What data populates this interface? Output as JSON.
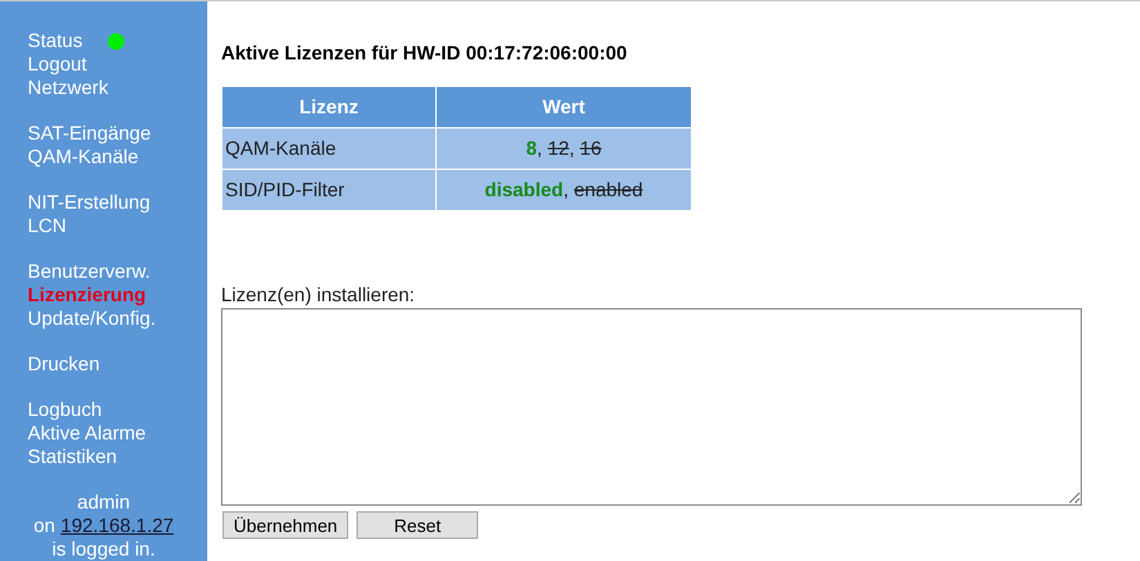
{
  "sidebar": {
    "groups": [
      [
        {
          "label": "Status",
          "selected": false,
          "color": "#00ee00"
        },
        {
          "label": "Logout",
          "selected": false
        },
        {
          "label": "Netzwerk",
          "selected": false
        }
      ],
      [
        {
          "label": "SAT-Eingänge",
          "selected": false
        },
        {
          "label": "QAM-Kanäle",
          "selected": false
        }
      ],
      [
        {
          "label": "NIT-Erstellung",
          "selected": false
        },
        {
          "label": "LCN",
          "selected": false
        }
      ],
      [
        {
          "label": "Benutzerverw.",
          "selected": false
        },
        {
          "label": "Lizenzierung",
          "selected": true
        },
        {
          "label": "Update/Konfig.",
          "selected": false
        }
      ],
      [
        {
          "label": "Drucken",
          "selected": false
        }
      ],
      [
        {
          "label": "Logbuch",
          "selected": false
        },
        {
          "label": "Aktive Alarme",
          "selected": false
        },
        {
          "label": "Statistiken",
          "selected": false
        }
      ]
    ],
    "user": {
      "name": "admin",
      "prefix": "on",
      "address": "192.168.1.27",
      "suffix": "is logged in."
    }
  },
  "title": "Aktive Lizenzen für HW-ID 00:17:72:06:00:00",
  "table": {
    "columns": [
      "Lizenz",
      "Wert"
    ],
    "rows": [
      {
        "license": "QAM-Kanäle",
        "separator": ", ",
        "options": [
          {
            "text": "8",
            "active": true
          },
          {
            "text": "12",
            "active": false
          },
          {
            "text": "16",
            "active": false
          }
        ]
      },
      {
        "license": "SID/PID-Filter",
        "separator": ", ",
        "options": [
          {
            "text": "disabled",
            "active": true
          },
          {
            "text": "enabled",
            "active": false
          }
        ]
      }
    ]
  },
  "install": {
    "label": "Lizenz(en) installieren:"
  },
  "buttons": [
    "Übernehmen",
    "Reset"
  ]
}
